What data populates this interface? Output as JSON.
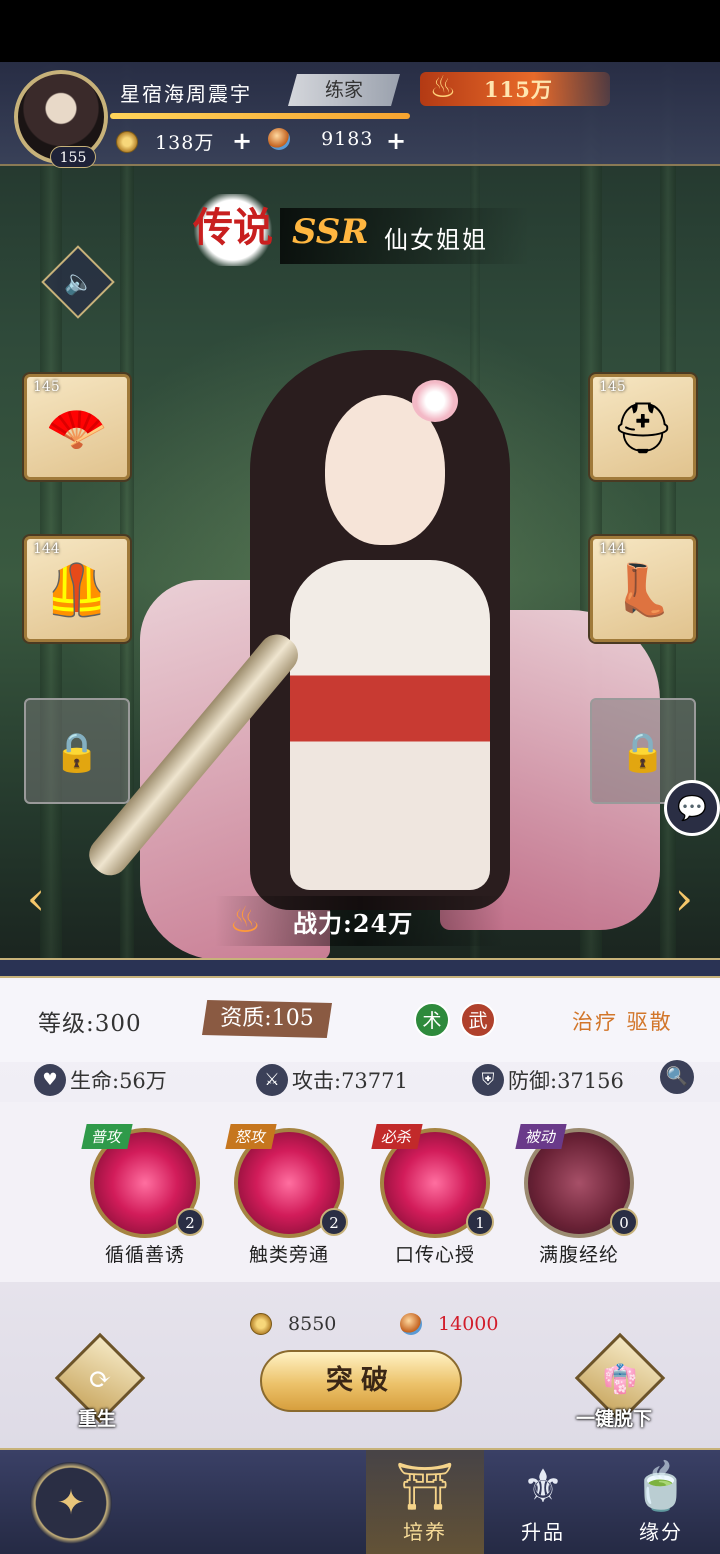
{
  "player": {
    "name": "星宿海周震宇",
    "level": "155",
    "rank": "练家",
    "power": "115万",
    "coins": "138万",
    "gems": "9183"
  },
  "hero": {
    "rarity_badge": "传说",
    "grade": "SSR",
    "name": "仙女姐姐",
    "battle_power": "战力:24万"
  },
  "equipment": [
    {
      "level": "145",
      "item": "fan",
      "glyph": "🪭"
    },
    {
      "level": "145",
      "item": "helmet",
      "glyph": "⛑"
    },
    {
      "level": "144",
      "item": "armor",
      "glyph": "🦺"
    },
    {
      "level": "144",
      "item": "boots",
      "glyph": "👢"
    },
    {
      "glyph": "🔒"
    },
    {
      "glyph": "🔒"
    }
  ],
  "stats_panel": {
    "level": "等级:300",
    "quality": "资质:105",
    "tag1": "术",
    "tag2": "武",
    "traits": "治疗 驱散",
    "hp": "生命:56万",
    "attack": "攻击:73771",
    "defense": "防御:37156"
  },
  "skills": [
    {
      "kind": "普攻",
      "name": "循循善诱",
      "count": "2"
    },
    {
      "kind": "怒攻",
      "name": "触类旁通",
      "count": "2"
    },
    {
      "kind": "必杀",
      "name": "口传心授",
      "count": "1"
    },
    {
      "kind": "被动",
      "name": "满腹经纶",
      "count": "0"
    }
  ],
  "costs": {
    "coin_cost": "8550",
    "gem_cost": "14000"
  },
  "actions": {
    "rebirth": "重生",
    "breakthrough": "突破",
    "unequip_all": "一键脱下"
  },
  "nav": {
    "tabs": [
      "培养",
      "升品",
      "缘分"
    ]
  },
  "colors": {
    "accent_gold": "#c7b27a",
    "trait_orange": "#d2762a",
    "cost_red": "#d21c2a",
    "nav_bg": "#252a44"
  }
}
